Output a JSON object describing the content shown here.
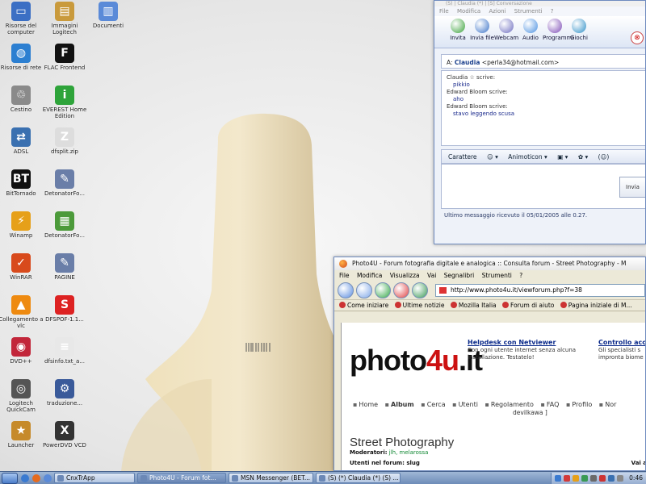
{
  "desktop": {
    "icons": [
      {
        "label": "Risorse del computer",
        "icon": "computer-icon",
        "color": "#3b6fc4"
      },
      {
        "label": "Immagini Logitech",
        "icon": "folder-images-icon",
        "color": "#c99a3c"
      },
      {
        "label": "Documenti",
        "icon": "documents-folder-icon",
        "color": "#5a8ad8"
      },
      {
        "label": "Risorse di rete",
        "icon": "network-globe-icon",
        "color": "#2c7fd1"
      },
      {
        "label": "FLAC Frontend",
        "icon": "flac-icon",
        "color": "#111111"
      },
      {
        "label": "Cestino",
        "icon": "recycle-bin-icon",
        "color": "#8a8a8a"
      },
      {
        "label": "EVEREST Home Edition",
        "icon": "info-icon",
        "color": "#2ea43a"
      },
      {
        "label": "ADSL",
        "icon": "network-connection-icon",
        "color": "#3a70b0"
      },
      {
        "label": "dfsplit.zip",
        "icon": "zip-file-icon",
        "color": "#dddddd"
      },
      {
        "label": "BitTornado",
        "icon": "bittornado-icon",
        "color": "#111111"
      },
      {
        "label": "DetonatorFo...",
        "icon": "script-file-icon",
        "color": "#6a7ea8"
      },
      {
        "label": "Winamp",
        "icon": "winamp-icon",
        "color": "#e6a019"
      },
      {
        "label": "DetonatorFo...",
        "icon": "archive-icon",
        "color": "#4c9a3a"
      },
      {
        "label": "WinRAR",
        "icon": "winrar-icon",
        "color": "#d84a1c"
      },
      {
        "label": "PAGINE",
        "icon": "script-file-icon",
        "color": "#6a7ea8"
      },
      {
        "label": "Collegamento a vlc",
        "icon": "vlc-cone-icon",
        "color": "#ee8a10"
      },
      {
        "label": "DFSPOF-1.1...",
        "icon": "s-app-icon",
        "color": "#dd2222"
      },
      {
        "label": "DVD++",
        "icon": "dvd-disc-icon",
        "color": "#c2263a"
      },
      {
        "label": "dfsinfo.txt_a...",
        "icon": "text-file-icon",
        "color": "#e8e8e8"
      },
      {
        "label": "Logitech QuickCam",
        "icon": "webcam-icon",
        "color": "#555555"
      },
      {
        "label": "traduzione...",
        "icon": "setup-icon",
        "color": "#3a5a9a"
      },
      {
        "label": "Launcher",
        "icon": "launcher-star-icon",
        "color": "#c68a2a"
      },
      {
        "label": "PowerDVD VCD",
        "icon": "powerdvd-icon",
        "color": "#333333"
      }
    ]
  },
  "msn": {
    "title": "(S) | Claudia (*) | [S] Conversazione",
    "menu": [
      "File",
      "Modifica",
      "Azioni",
      "Strumenti",
      "?"
    ],
    "toolbar": [
      "Invita",
      "Invia file",
      "Webcam",
      "Audio",
      "Programmi",
      "Giochi"
    ],
    "toolbar_colors": [
      "#3aa13a",
      "#3b73c8",
      "#6c6cbf",
      "#4a8fe0",
      "#7d4bb5",
      "#2f8fc7"
    ],
    "close_symbol": "⊗",
    "to_label": "A:",
    "to_name": "Claudia",
    "to_email": "<perla34@hotmail.com>",
    "lines": [
      {
        "type": "who",
        "text": "Claudia ☆ scrive:"
      },
      {
        "type": "msg",
        "text": "pikkio"
      },
      {
        "type": "who",
        "text": "Edward Bloom scrive:"
      },
      {
        "type": "msg",
        "text": "aho"
      },
      {
        "type": "who",
        "text": "Edward Bloom scrive:"
      },
      {
        "type": "msg",
        "text": "stavo leggendo scusa"
      }
    ],
    "format_bar": [
      "Carattere",
      "☺ ▾",
      "Animoticon ▾",
      "▣ ▾",
      "✿ ▾",
      "(☺)"
    ],
    "send_label": "Invia",
    "status": "Ultimo messaggio ricevuto il 05/01/2005 alle 0.27."
  },
  "firefox": {
    "title": "Photo4U - Forum fotografia digitale e analogica :: Consulta forum - Street Photography - M",
    "menu": [
      "File",
      "Modifica",
      "Visualizza",
      "Vai",
      "Segnalibri",
      "Strumenti",
      "?"
    ],
    "nav_colors": [
      "#5b8de0",
      "#7ea6e8",
      "#35a848",
      "#e04040",
      "#3a9a55"
    ],
    "url": "http://www.photo4u.it/viewforum.php?f=38",
    "bookmarks": [
      "Come iniziare",
      "Ultime notizie",
      "Mozilla Italia",
      "Forum di aiuto",
      "Pagina iniziale di M..."
    ],
    "page": {
      "logo_main": "photo",
      "logo_accent": "4u",
      "logo_tail": ".it",
      "promo1_title": "Helpdesk con Netviewer",
      "promo1_text": "Con ogni utente internet senza alcuna installazione. Testatelo!",
      "promo2_title": "Controllo acc",
      "promo2_text": "Gli specialisti s impronta biome",
      "nav": [
        "Home",
        "Album",
        "Cerca",
        "Utenti",
        "Regolamento",
        "FAQ",
        "Profilo",
        "Nor"
      ],
      "nav_sub": "devilkawa ]",
      "forum_title": "Street Photography",
      "moderators_label": "Moderatori:",
      "moderators": "jlh, melarossa",
      "users_line": "Utenti nel forum: slug",
      "goto": "Vai a"
    }
  },
  "taskbar": {
    "tasks": [
      {
        "label": "CnxTrApp",
        "active": false
      },
      {
        "label": "Photo4U - Forum fot...",
        "active": true
      },
      {
        "label": "MSN Messenger (BET...",
        "active": false
      },
      {
        "label": "(S) (*) Claudia (*) (S) ...",
        "active": false
      }
    ],
    "quicklaunch_colors": [
      "#3a7ad0",
      "#e56b1f",
      "#5a8ad8"
    ],
    "tray_colors": [
      "#3a7ad0",
      "#d23a3a",
      "#e6a019",
      "#3a9a55",
      "#6a6a6a",
      "#c33",
      "#3a70b0",
      "#888"
    ],
    "clock": "0:46"
  }
}
